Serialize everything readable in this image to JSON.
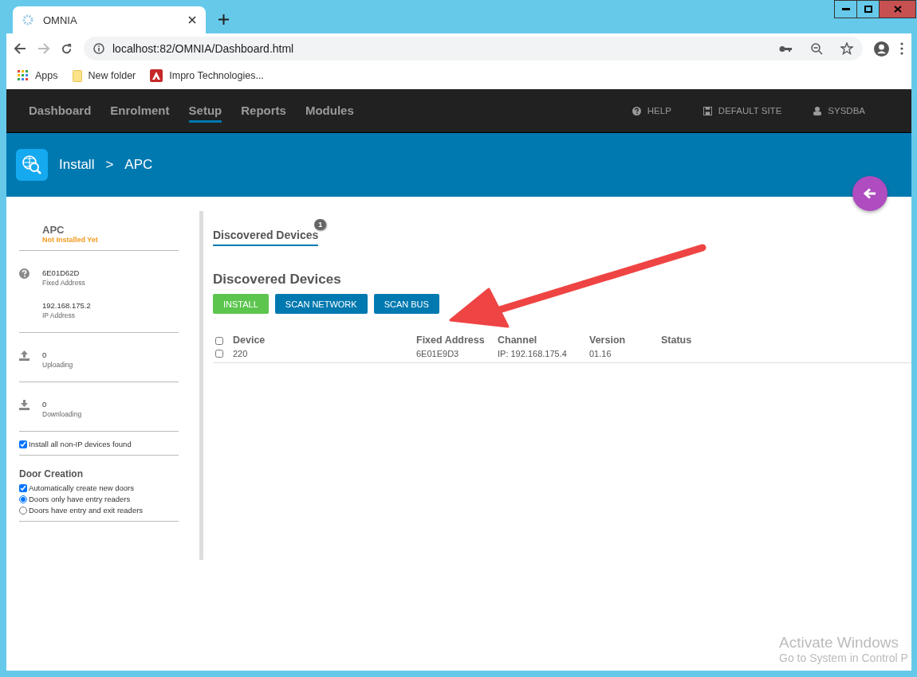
{
  "browser": {
    "tab": {
      "title": "OMNIA"
    },
    "address": "localhost:82/OMNIA/Dashboard.html",
    "bookmarks": [
      {
        "kind": "apps",
        "label": "Apps"
      },
      {
        "kind": "folder",
        "label": "New folder"
      },
      {
        "kind": "site",
        "label": "Impro Technologies..."
      }
    ]
  },
  "nav": {
    "items": [
      {
        "label": "Dashboard",
        "selected": false
      },
      {
        "label": "Enrolment",
        "selected": false
      },
      {
        "label": "Setup",
        "selected": true
      },
      {
        "label": "Reports",
        "selected": false
      },
      {
        "label": "Modules",
        "selected": false
      }
    ],
    "right": [
      {
        "kind": "help",
        "label": "HELP"
      },
      {
        "kind": "site",
        "label": "DEFAULT SITE"
      },
      {
        "kind": "user",
        "label": "SYSDBA"
      }
    ]
  },
  "header": {
    "breadcrumb": [
      "Install",
      "APC"
    ],
    "separator": ">"
  },
  "sidebar": {
    "title": "APC",
    "status": "Not Installed Yet",
    "details": [
      {
        "kind": "unknown",
        "value": "6E01D62D",
        "label": "Fixed Address"
      },
      {
        "kind": "plain",
        "value": "192.168.175.2",
        "label": "IP Address"
      }
    ],
    "transfers": [
      {
        "kind": "upload",
        "value": "0",
        "label": "Uploading"
      },
      {
        "kind": "download",
        "value": "0",
        "label": "Downloading"
      }
    ],
    "install_all": {
      "label": "Install all non-IP devices found",
      "checked": true
    },
    "door_creation": {
      "title": "Door Creation",
      "auto_create": {
        "label": "Automatically create new doors",
        "checked": true
      },
      "options": [
        {
          "label": "Doors only have entry readers",
          "selected": true
        },
        {
          "label": "Doors have entry and exit readers",
          "selected": false
        }
      ]
    }
  },
  "main": {
    "tabs": [
      {
        "label": "Discovered Devices",
        "badge": "1",
        "selected": true
      }
    ],
    "heading": "Discovered Devices",
    "buttons": [
      {
        "kind": "success",
        "label": "INSTALL"
      },
      {
        "kind": "primary",
        "label": "SCAN NETWORK"
      },
      {
        "kind": "primary",
        "label": "SCAN BUS"
      }
    ],
    "table": {
      "columns": [
        "Device",
        "Fixed Address",
        "Channel",
        "Version",
        "Status"
      ],
      "all_checked": false,
      "rows": [
        {
          "checked": false,
          "cells": [
            "220",
            "6E01E9D3",
            "IP: 192.168.175.4",
            "01.16",
            ""
          ]
        }
      ]
    }
  },
  "os_notice": {
    "title": "Activate Windows",
    "subtitle": "Go to System in Control P"
  }
}
